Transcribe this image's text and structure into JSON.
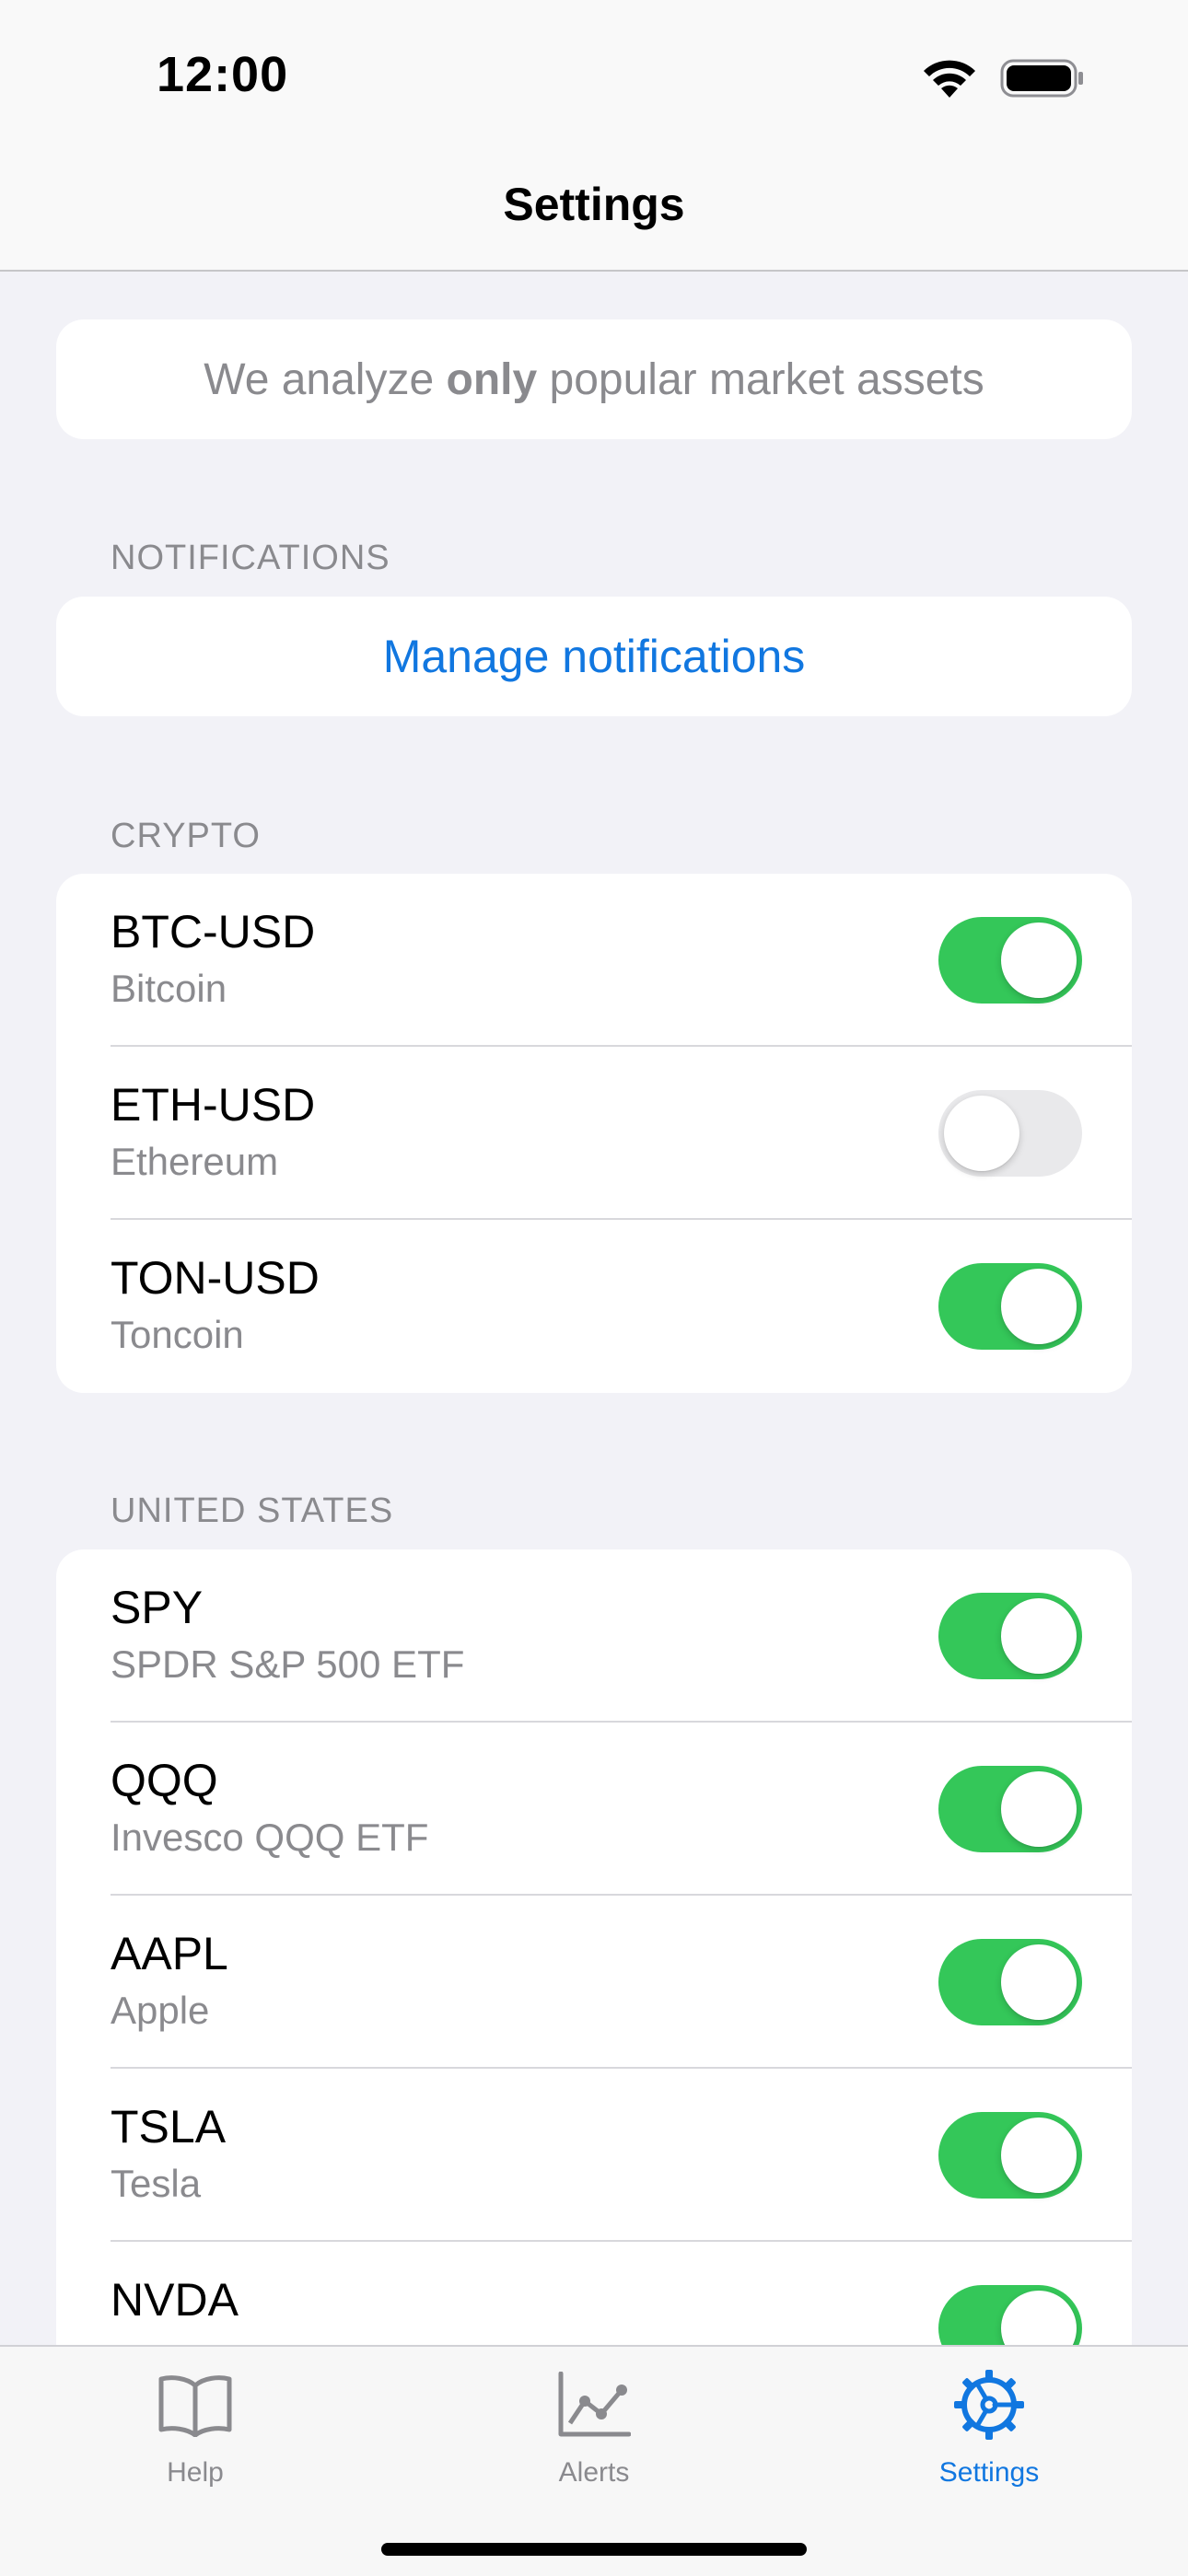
{
  "status_bar": {
    "time": "12:00"
  },
  "nav": {
    "title": "Settings"
  },
  "info": {
    "prefix": "We analyze ",
    "emphasis": "only",
    "suffix": " popular market assets"
  },
  "notifications": {
    "header": "NOTIFICATIONS",
    "manage_label": "Manage notifications"
  },
  "crypto": {
    "header": "CRYPTO",
    "items": [
      {
        "symbol": "BTC-USD",
        "name": "Bitcoin",
        "enabled": true
      },
      {
        "symbol": "ETH-USD",
        "name": "Ethereum",
        "enabled": false
      },
      {
        "symbol": "TON-USD",
        "name": "Toncoin",
        "enabled": true
      }
    ]
  },
  "united_states": {
    "header": "UNITED STATES",
    "items": [
      {
        "symbol": "SPY",
        "name": "SPDR S&P 500 ETF",
        "enabled": true
      },
      {
        "symbol": "QQQ",
        "name": "Invesco QQQ ETF",
        "enabled": true
      },
      {
        "symbol": "AAPL",
        "name": "Apple",
        "enabled": true
      },
      {
        "symbol": "TSLA",
        "name": "Tesla",
        "enabled": true
      },
      {
        "symbol": "NVDA",
        "name": "",
        "enabled": true
      }
    ]
  },
  "tabs": [
    {
      "label": "Help",
      "icon": "book-icon",
      "active": false
    },
    {
      "label": "Alerts",
      "icon": "chart-icon",
      "active": false
    },
    {
      "label": "Settings",
      "icon": "gear-icon",
      "active": true
    }
  ],
  "colors": {
    "accent": "#1177e0",
    "toggle_on": "#34c759",
    "toggle_off": "#e9e9eb",
    "background": "#f2f2f7",
    "secondary_text": "#8a8a8e"
  }
}
